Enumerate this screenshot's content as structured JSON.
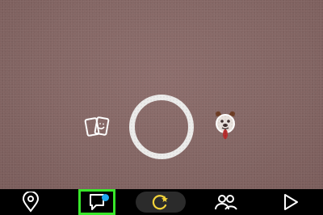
{
  "colors": {
    "viewfinder": "#846664",
    "navbar": "#000000",
    "icon": "#ffffff",
    "highlight": "#38e62a",
    "notification": "#1fa8ef",
    "camera_pill": "#2b2b2b",
    "lens_accent": "#f2d23a"
  },
  "camera": {
    "controls": [
      {
        "name": "memories",
        "icon": "memories-cards-icon"
      },
      {
        "name": "capture",
        "icon": "capture-ring"
      },
      {
        "name": "lens",
        "icon": "dog-lens-icon"
      }
    ]
  },
  "navbar": {
    "items": [
      {
        "name": "map",
        "icon": "location-pin-icon"
      },
      {
        "name": "chat",
        "icon": "chat-bubble-icon",
        "highlighted": true,
        "notification": true
      },
      {
        "name": "camera",
        "icon": "camera-sparkle-icon",
        "active": true
      },
      {
        "name": "stories",
        "icon": "friends-icon"
      },
      {
        "name": "discover",
        "icon": "play-icon"
      }
    ]
  }
}
